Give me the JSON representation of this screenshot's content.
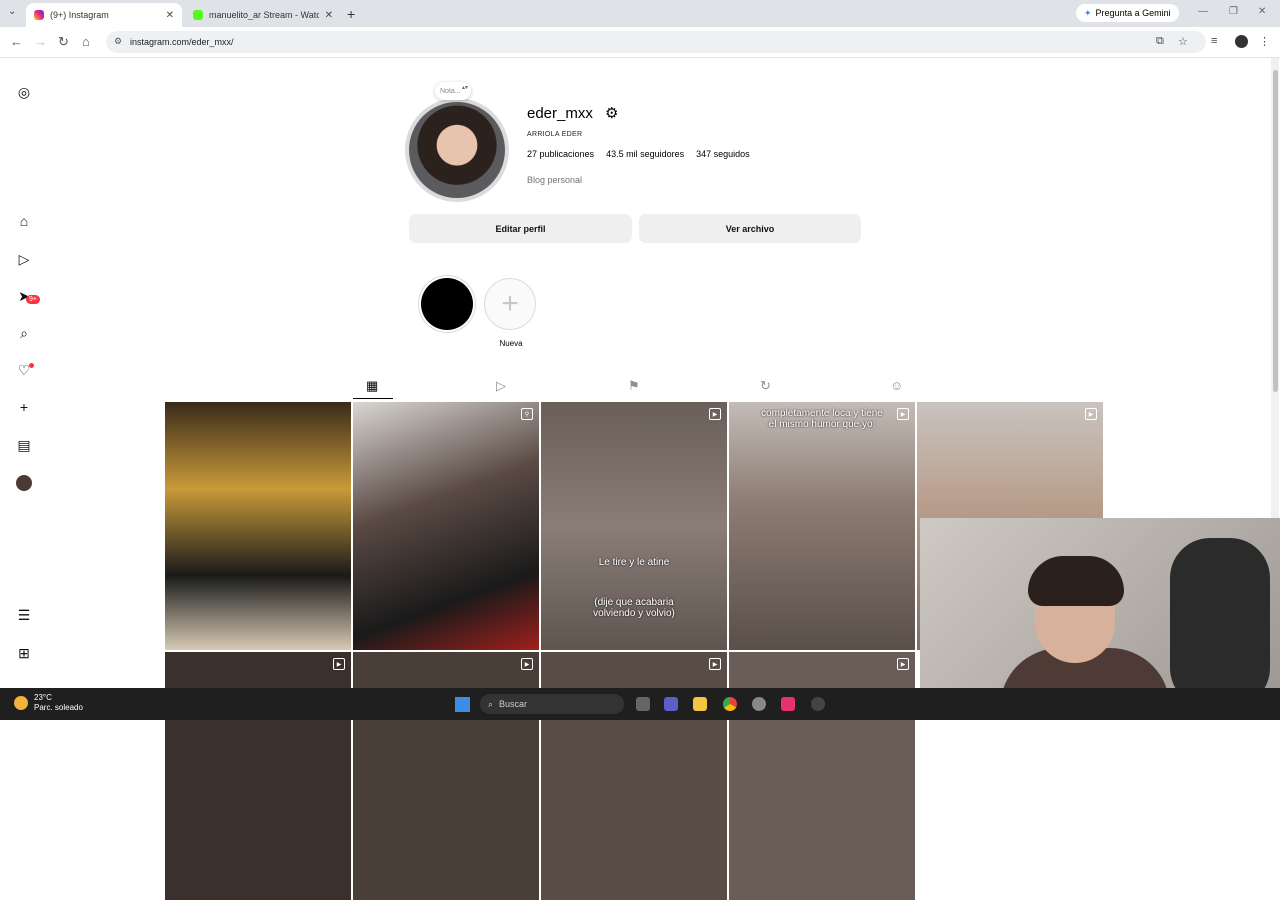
{
  "browser": {
    "tabs": [
      {
        "label": "(9+) Instagram",
        "active": true
      },
      {
        "label": "manuelito_ar Stream - Watch Li",
        "active": false
      }
    ],
    "gemini_label": "Pregunta a Gemini",
    "url": "instagram.com/eder_mxx/"
  },
  "profile": {
    "note_label": "Nota...",
    "username": "eder_mxx",
    "full_name": "ARRIOLA EDER",
    "stats": {
      "posts": "27 publicaciones",
      "followers": "43.5 mil seguidores",
      "following": "347 seguidos"
    },
    "bio": "Blog personal",
    "edit_button": "Editar perfil",
    "archive_button": "Ver archivo",
    "highlight_new_label": "Nueva"
  },
  "sidebar": {
    "messages_badge": "9+"
  },
  "posts": [
    {
      "text": ""
    },
    {
      "text": ""
    },
    {
      "text_top": "Le tire y le atine",
      "text_bottom": "(dije que acabaria volviendo y volvio)"
    },
    {
      "text_top_overlay": "completamente loca y tiene el mismo humor que yo:"
    },
    {
      "text": ""
    }
  ],
  "taskbar": {
    "temperature": "23°C",
    "weather_desc": "Parc. soleado",
    "search_placeholder": "Buscar"
  },
  "colors": {
    "badge": "#ff3040",
    "button_bg": "#efefef"
  }
}
